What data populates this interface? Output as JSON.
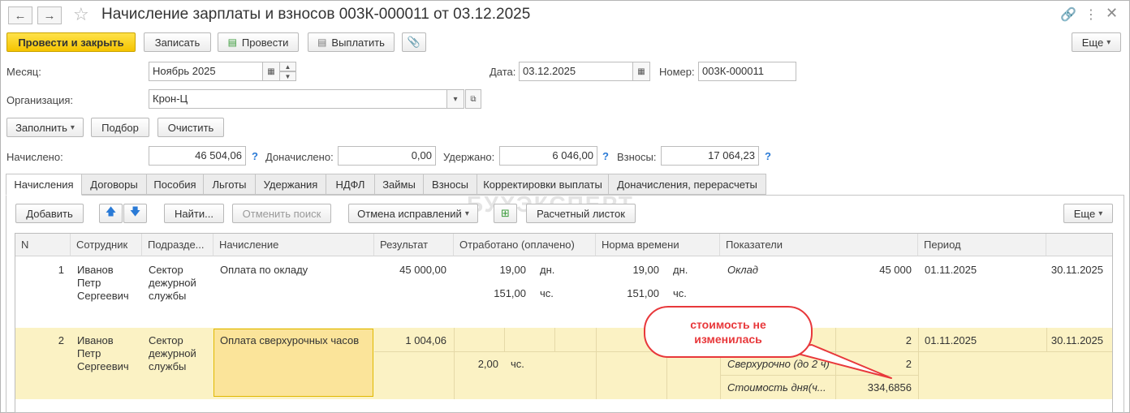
{
  "window": {
    "title": "Начисление зарплаты и взносов 003К-000011 от 03.12.2025"
  },
  "toolbar": {
    "post_close": "Провести и закрыть",
    "save": "Записать",
    "post": "Провести",
    "pay": "Выплатить",
    "more": "Еще"
  },
  "form": {
    "month_label": "Месяц:",
    "month_value": "Ноябрь 2025",
    "date_label": "Дата:",
    "date_value": "03.12.2025",
    "number_label": "Номер:",
    "number_value": "003К-000011",
    "org_label": "Организация:",
    "org_value": "Крон-Ц"
  },
  "actions": {
    "fill": "Заполнить",
    "select": "Подбор",
    "clear": "Очистить"
  },
  "totals": {
    "accrued_label": "Начислено:",
    "accrued_value": "46 504,06",
    "additional_label": "Доначислено:",
    "additional_value": "0,00",
    "withheld_label": "Удержано:",
    "withheld_value": "6 046,00",
    "contrib_label": "Взносы:",
    "contrib_value": "17 064,23",
    "help": "?"
  },
  "tabs": [
    "Начисления",
    "Договоры",
    "Пособия",
    "Льготы",
    "Удержания",
    "НДФЛ",
    "Займы",
    "Взносы",
    "Корректировки выплаты",
    "Доначисления, перерасчеты"
  ],
  "table_toolbar": {
    "add": "Добавить",
    "find": "Найти...",
    "cancel_search": "Отменить поиск",
    "cancel_corrections": "Отмена исправлений",
    "pay_slip": "Расчетный листок",
    "more": "Еще"
  },
  "watermark": "БУХЭКСПЕРТ",
  "table": {
    "columns": [
      "N",
      "Сотрудник",
      "Подразде...",
      "Начисление",
      "Результат",
      "Отработано (оплачено)",
      "Норма времени",
      "Показатели",
      "Период"
    ],
    "rows": [
      {
        "n": "1",
        "employee": [
          "Иванов",
          "Петр",
          "Сергеевич"
        ],
        "dept": [
          "Сектор",
          "дежурной",
          "службы"
        ],
        "accrual": "Оплата по окладу",
        "result": "45 000,00",
        "worked": [
          {
            "v": "19,00",
            "u": "дн."
          },
          {
            "v": "151,00",
            "u": "чс."
          }
        ],
        "norm": [
          {
            "v": "19,00",
            "u": "дн."
          },
          {
            "v": "151,00",
            "u": "чс."
          }
        ],
        "indicator_name": "Оклад",
        "indicator_value": "45 000",
        "period_from": "01.11.2025",
        "period_to": "30.11.2025"
      },
      {
        "n": "2",
        "employee": [
          "Иванов",
          "Петр",
          "Сергеевич"
        ],
        "dept": [
          "Сектор",
          "дежурной",
          "службы"
        ],
        "accrual": "Оплата сверхурочных часов",
        "result": "1 004,06",
        "worked_value": "2,00",
        "worked_unit": "чс.",
        "indicators": [
          {
            "name": "",
            "value": "2"
          },
          {
            "name": "Сверхурочно (до 2 ч)",
            "value": "2"
          },
          {
            "name": "Стоимость дня(ч...",
            "value": "334,6856"
          }
        ],
        "period_from": "01.11.2025",
        "period_to": "30.11.2025"
      }
    ]
  },
  "callout": {
    "line1": "стоимость не",
    "line2": "изменилась",
    "color": "#e8383b"
  }
}
